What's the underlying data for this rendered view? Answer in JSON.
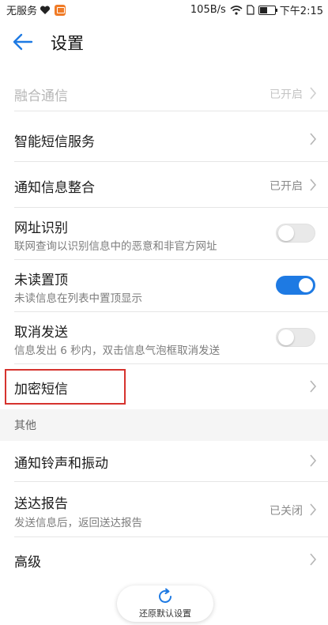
{
  "status_bar": {
    "carrier": "无服务",
    "speed": "105B/s",
    "time": "下午2:15"
  },
  "header": {
    "title": "设置",
    "accent": "#1e7ae3"
  },
  "rows": [
    {
      "label": "融合通信",
      "value": "已开启",
      "disabled": true
    },
    {
      "label": "智能短信服务"
    },
    {
      "label": "通知信息整合",
      "value": "已开启"
    },
    {
      "label": "网址识别",
      "sub": "联网查询以识别信息中的恶意和非官方网址",
      "toggle": false
    },
    {
      "label": "未读置顶",
      "sub": "未读信息在列表中置顶显示",
      "toggle": true
    },
    {
      "label": "取消发送",
      "sub": "信息发出 6 秒内，双击信息气泡框取消发送",
      "toggle": false
    },
    {
      "label": "加密短信"
    }
  ],
  "section_other": {
    "title": "其他",
    "rows": [
      {
        "label": "通知铃声和振动"
      },
      {
        "label": "送达报告",
        "sub": "发送信息后，返回送达报告",
        "value": "已关闭"
      },
      {
        "label": "高级"
      }
    ]
  },
  "restore_button": {
    "label": "还原默认设置"
  }
}
